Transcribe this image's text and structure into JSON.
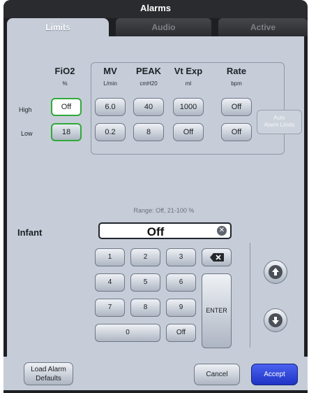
{
  "window": {
    "title": "Alarms"
  },
  "tabs": [
    {
      "label": "Limits",
      "active": true
    },
    {
      "label": "Audio",
      "active": false
    },
    {
      "label": "Active",
      "active": false
    }
  ],
  "limits": {
    "fio2": {
      "header": "FiO2",
      "unit": "%",
      "high": "Off",
      "low": "18"
    },
    "row_labels": {
      "high": "High",
      "low": "Low"
    },
    "columns": [
      {
        "header": "MV",
        "unit": "L/min",
        "high": "6.0",
        "low": "0.2"
      },
      {
        "header": "PEAK",
        "unit": "cmH20",
        "high": "40",
        "low": "8"
      },
      {
        "header": "Vt Exp",
        "unit": "ml",
        "high": "1000",
        "low": "Off"
      },
      {
        "header": "Rate",
        "unit": "bpm",
        "high": "Off",
        "low": "Off"
      }
    ],
    "auto_button": {
      "line1": "Auto",
      "line2": "Alarm Limits"
    }
  },
  "editor": {
    "range_text": "Range: Off, 21-100 %",
    "patient_type": "Infant",
    "value": "Off",
    "keys": [
      "1",
      "2",
      "3",
      "4",
      "5",
      "6",
      "7",
      "8",
      "9",
      "0",
      "Off"
    ],
    "enter_label": "ENTER"
  },
  "footer": {
    "load_defaults_line1": "Load Alarm",
    "load_defaults_line2": "Defaults",
    "cancel_label": "Cancel",
    "accept_label": "Accept"
  },
  "colors": {
    "accent_green": "#31a93a",
    "accept_blue": "#2c43d6",
    "panel": "#c6cdd8"
  }
}
